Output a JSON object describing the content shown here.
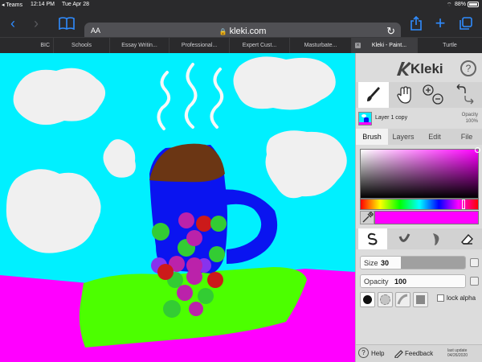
{
  "status_bar": {
    "back_app": "Teams",
    "time": "12:14 PM",
    "date": "Tue Apr 28",
    "battery": "88%"
  },
  "toolbar": {
    "icons": [
      "back-icon",
      "forward-icon",
      "bookmarks-icon",
      "share-icon",
      "new-tab-icon",
      "tabs-icon"
    ],
    "address": {
      "text_size_label": "AA",
      "url": "kleki.com"
    }
  },
  "tabs": [
    {
      "label": "BIC"
    },
    {
      "label": "Schools"
    },
    {
      "label": "Essay Writin..."
    },
    {
      "label": "Professional..."
    },
    {
      "label": "Expert Cust..."
    },
    {
      "label": "Masturbate..."
    },
    {
      "label": "Kleki - Paint...",
      "active": true
    },
    {
      "label": "Turtle"
    }
  ],
  "app": {
    "name": "Kleki",
    "help_glyph": "?",
    "tools": [
      "brush-tool-icon",
      "hand-tool-icon",
      "zoom-in-icon",
      "zoom-out-icon",
      "undo-icon",
      "redo-icon"
    ],
    "layer": {
      "name": "Layer 1 copy",
      "opacity_label": "Opacity",
      "opacity_value": "100%"
    },
    "subtabs": [
      "Brush",
      "Layers",
      "Edit",
      "File"
    ],
    "colors": {
      "primary": "#ff00ff",
      "sky": "#00f0ff"
    },
    "brushes": [
      "pen-brush-icon",
      "blend-brush-icon",
      "sketchy-brush-icon",
      "eraser-icon"
    ],
    "size": {
      "label": "Size",
      "value": "30"
    },
    "opacity": {
      "label": "Opacity",
      "value": "100"
    },
    "lock_alpha": "lock alpha",
    "footer": {
      "help": "Help",
      "feedback": "Feedback",
      "update_label": "last update",
      "update_date": "04/26/2020"
    }
  }
}
